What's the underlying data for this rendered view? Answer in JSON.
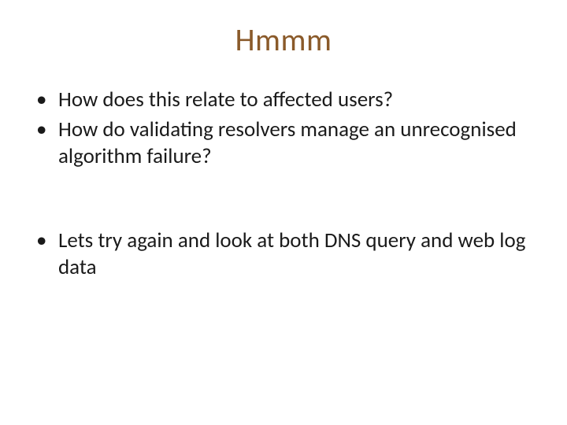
{
  "title": "Hmmm",
  "bullets_top": [
    "How does this relate to affected users?",
    "How do validating resolvers manage an unrecognised algorithm failure?"
  ],
  "bullets_bottom": [
    "Lets try again and look at both DNS query and web log data"
  ]
}
